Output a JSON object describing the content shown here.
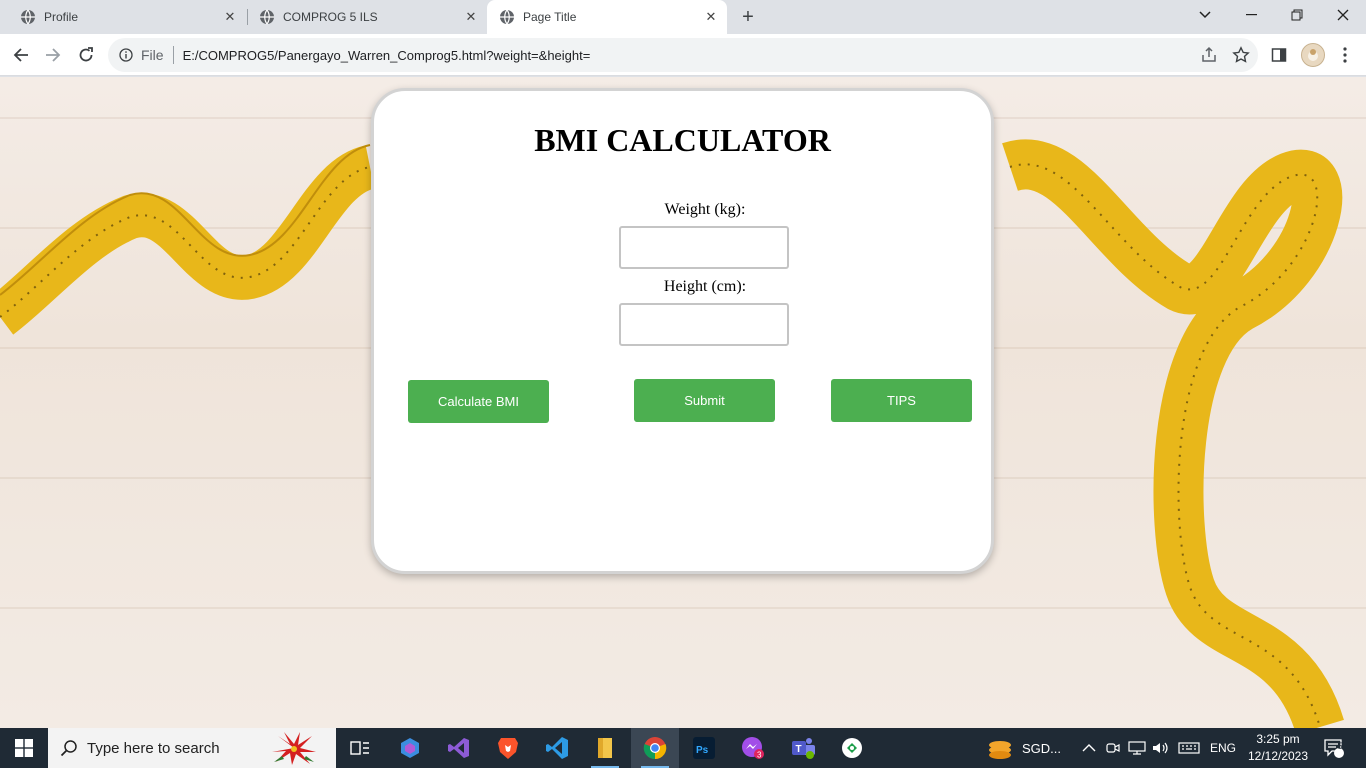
{
  "browser": {
    "tabs": [
      {
        "title": "Profile",
        "active": false
      },
      {
        "title": "COMPROG 5 ILS",
        "active": false
      },
      {
        "title": "Page Title",
        "active": true
      }
    ],
    "address": {
      "scheme_label": "File",
      "url": "E:/COMPROG5/Panergayo_Warren_Comprog5.html?weight=&height="
    }
  },
  "page": {
    "title": "BMI CALCULATOR",
    "weight_label": "Weight (kg):",
    "height_label": "Height (cm):",
    "weight_value": "",
    "height_value": "",
    "buttons": {
      "calculate": "Calculate BMI",
      "submit": "Submit",
      "tips": "TIPS"
    },
    "accent_color": "#4caf50"
  },
  "taskbar": {
    "search_placeholder": "Type here to search",
    "weather_label": "SGD...",
    "language": "ENG",
    "time": "3:25 pm",
    "date": "12/12/2023",
    "notification_count": "5",
    "apps": [
      "task-view",
      "copilot",
      "visual-studio",
      "brave",
      "vscode",
      "file-explorer",
      "chrome",
      "photoshop",
      "messenger",
      "teams",
      "sync-app"
    ]
  }
}
